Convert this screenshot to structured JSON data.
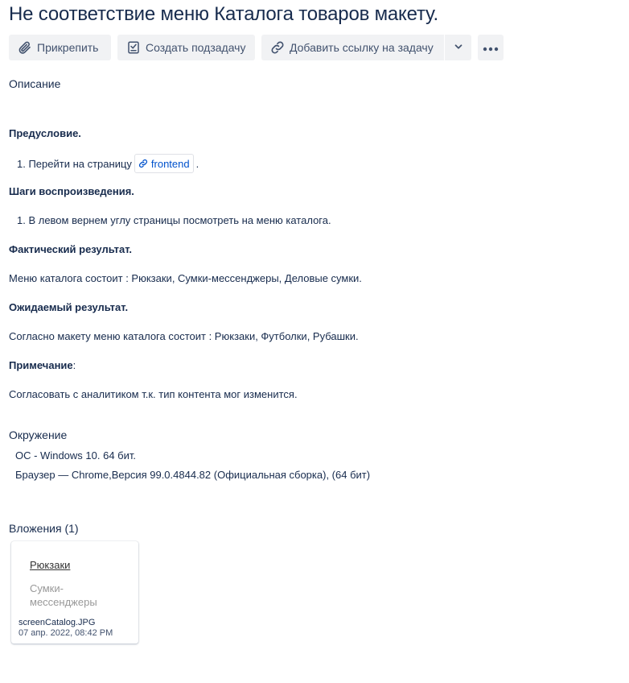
{
  "issue": {
    "title": "Не соответствие меню Каталога товаров макету."
  },
  "toolbar": {
    "attach_label": "Прикрепить",
    "create_subtask_label": "Создать подзадачу",
    "link_issue_label": "Добавить ссылку на задачу"
  },
  "description": {
    "label": "Описание",
    "precondition_heading": "Предусловие.",
    "precondition_step": "1. Перейти на страницу",
    "precondition_link": "frontend",
    "precondition_suffix": ".",
    "steps_heading": "Шаги воспроизведения.",
    "step_1": "1. В левом вернем углу страницы посмотреть на меню каталога.",
    "actual_heading": "Фактический результат.",
    "actual_text": "Меню каталога состоит : Рюкзаки, Сумки-мессенджеры, Деловые сумки.",
    "expected_heading": "Ожидаемый результат.",
    "expected_text": "Согласно макету меню каталога состоит : Рюкзаки, Футболки, Рубашки.",
    "note_heading": "Примечание",
    "note_colon": ":",
    "note_text": "Согласовать с аналитиком т.к. тип контента мог изменится."
  },
  "environment": {
    "label": "Окружение",
    "os": "ОС - Windows 10. 64 бит.",
    "browser": "Браузер — Chrome,Версия 99.0.4844.82 (Официальная сборка), (64 бит)"
  },
  "attachments": {
    "label": "Вложения (1)",
    "items": [
      {
        "thumb_line_1": "Рюкзаки",
        "thumb_line_2": "Сумки-мессенджеры",
        "file_name": "screenCatalog.JPG",
        "date": "07 апр. 2022, 08:42 PM"
      }
    ]
  },
  "icons": {
    "attach": "paperclip-icon",
    "subtask": "checkbox-icon",
    "link": "link-icon",
    "dropdown": "chevron-down-icon",
    "more": "more-horizontal-icon"
  },
  "colors": {
    "text": "#172b4d",
    "button_bg": "#f1f2f4",
    "link": "#0052cc"
  }
}
